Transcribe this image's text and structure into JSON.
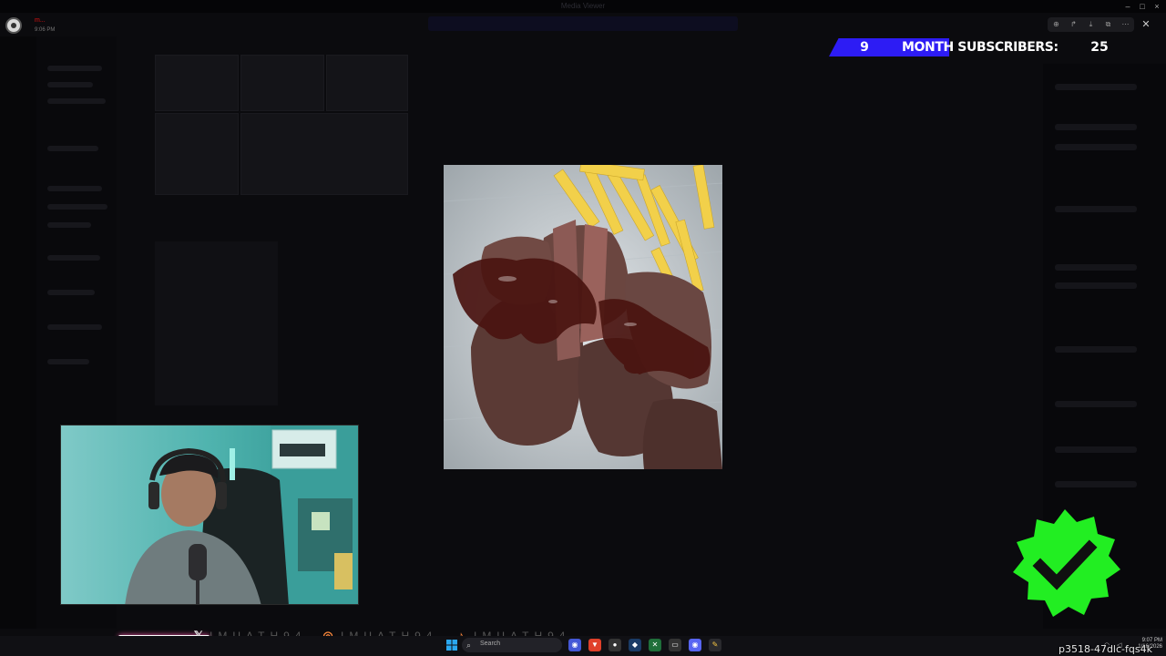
{
  "window": {
    "title": "Media Viewer"
  },
  "header": {
    "author": "m...",
    "timestamp": "9:06 PM"
  },
  "overlay": {
    "month_count": "9",
    "subscriber_label": "MONTH SUBSCRIBERS:",
    "subscriber_goal": "25"
  },
  "ticker": {
    "handle_1": "IMUATH94",
    "handle_2": "IMUATH94",
    "handle_3": "IMUATH94"
  },
  "taskbar": {
    "search_placeholder": "Search",
    "clock_time": "9:07 PM",
    "clock_date": "1/16/2026"
  },
  "watermark": "p3518-47dlc-fqs4k",
  "icons": {
    "verified_badge": "verified-check-icon",
    "colors": {
      "subscriber_strip": "#2d1cf4",
      "verified": "#22ee22",
      "ticker_icons": "#ff8a3d"
    }
  }
}
